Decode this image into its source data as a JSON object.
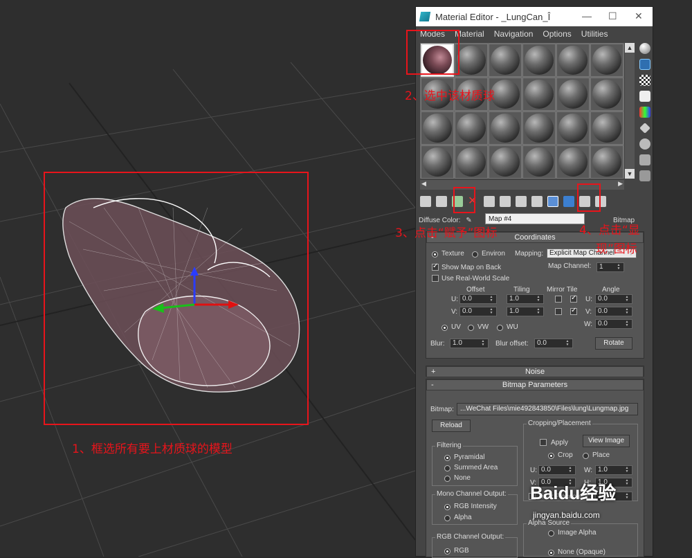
{
  "window": {
    "title": "Material Editor - _LungCan_Î",
    "menu": [
      "Modes",
      "Material",
      "Navigation",
      "Options",
      "Utilities"
    ]
  },
  "material_slots": {
    "count": 24,
    "selected_index": 0
  },
  "diffuse": {
    "label": "Diffuse Color:",
    "map_name": "Map #4",
    "map_type": "Bitmap"
  },
  "coordinates": {
    "header": "Coordinates",
    "texture_label": "Texture",
    "environ_label": "Environ",
    "mapping_label": "Mapping:",
    "mapping_value": "Explicit Map Channel",
    "map_channel_label": "Map Channel:",
    "map_channel_value": "1",
    "show_map_on_back": "Show Map on Back",
    "use_real_world_scale": "Use Real-World Scale",
    "offset_label": "Offset",
    "tiling_label": "Tiling",
    "mirror_tile_label": "Mirror Tile",
    "angle_label": "Angle",
    "u_label": "U:",
    "v_label": "V:",
    "w_label": "W:",
    "u_offset": "0.0",
    "v_offset": "0.0",
    "u_tiling": "1.0",
    "v_tiling": "1.0",
    "u_angle": "0.0",
    "v_angle": "0.0",
    "w_angle": "0.0",
    "uv": "UV",
    "vw": "VW",
    "wu": "WU",
    "blur_label": "Blur:",
    "blur_value": "1.0",
    "blur_offset_label": "Blur offset:",
    "blur_offset_value": "0.0",
    "rotate_button": "Rotate"
  },
  "noise": {
    "header": "Noise",
    "toggle": "+"
  },
  "bitmap_parameters": {
    "header": "Bitmap Parameters",
    "toggle": "-",
    "bitmap_label": "Bitmap:",
    "bitmap_path": "...WeChat Files\\mie492843850\\Files\\lung\\Lungmap.jpg",
    "reload_button": "Reload",
    "cropping_label": "Cropping/Placement",
    "apply_label": "Apply",
    "view_image_button": "View Image",
    "crop_label": "Crop",
    "place_label": "Place",
    "u_label": "U:",
    "v_label": "V:",
    "w_label": "W:",
    "h_label": "H:",
    "u_value": "0.0",
    "v_value": "0.0",
    "w_value": "1.0",
    "h_value": "1.0",
    "jitter_label": "Jitter Placement:",
    "jitter_value": "1.0",
    "filtering_label": "Filtering",
    "filter_pyramidal": "Pyramidal",
    "filter_summed_area": "Summed Area",
    "filter_none": "None",
    "mono_output_label": "Mono Channel Output:",
    "mono_rgb_intensity": "RGB Intensity",
    "mono_alpha": "Alpha",
    "alpha_source_label": "Alpha Source",
    "alpha_image_alpha": "Image Alpha",
    "alpha_none_opaque": "None (Opaque)",
    "rgb_output_label": "RGB Channel Output:",
    "rgb_option": "RGB"
  },
  "annotations": {
    "step1": "1、框选所有要上材质球的模型",
    "step2": "2、选中该材质球",
    "step3": "3、点击“赋予”图标",
    "step4_line1": "4、点击“显",
    "step4_line2": "现”图标"
  },
  "watermark": {
    "brand": "Baidu经验",
    "url": "jingyan.baidu.com"
  }
}
